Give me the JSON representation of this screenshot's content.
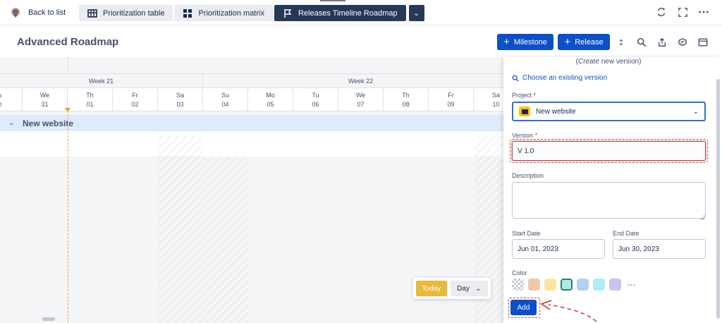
{
  "topbar": {
    "back_label": "Back to list",
    "tabs": [
      {
        "label": "Prioritization table",
        "icon": "table-icon",
        "active": false
      },
      {
        "label": "Prioritization matrix",
        "icon": "matrix-icon",
        "active": false
      },
      {
        "label": "Releases Timeline Roadmap",
        "icon": "flag-icon",
        "active": true
      }
    ],
    "icons": [
      "refresh-icon",
      "fullscreen-icon",
      "more-icon"
    ]
  },
  "header": {
    "title": "Advanced Roadmap",
    "milestone_label": "Milestone",
    "release_label": "Release",
    "icons": [
      "sort-icon",
      "search-icon",
      "share-icon",
      "comment-icon",
      "panel-icon"
    ]
  },
  "timeline": {
    "weeks": [
      {
        "label": "Week 21"
      },
      {
        "label": "Week 22"
      }
    ],
    "days": [
      {
        "dow": "u",
        "date": "0"
      },
      {
        "dow": "We",
        "date": "31"
      },
      {
        "dow": "Th",
        "date": "01"
      },
      {
        "dow": "Fr",
        "date": "02"
      },
      {
        "dow": "Sa",
        "date": "03"
      },
      {
        "dow": "Su",
        "date": "04"
      },
      {
        "dow": "Mo",
        "date": "05"
      },
      {
        "dow": "Tu",
        "date": "06"
      },
      {
        "dow": "We",
        "date": "07"
      },
      {
        "dow": "Th",
        "date": "08"
      },
      {
        "dow": "Fr",
        "date": "09"
      },
      {
        "dow": "Sa",
        "date": "10"
      }
    ],
    "group_name": "New website",
    "today_label": "Today",
    "zoom_label": "Day"
  },
  "panel": {
    "create_label": "(Create new version)",
    "choose_label": "Choose an existing version",
    "project_label": "Project",
    "project_value": "New website",
    "version_label": "Version",
    "version_value": "V 1.0",
    "description_label": "Description",
    "start_label": "Start Date",
    "start_value": "Jun 01, 2023",
    "end_label": "End Date",
    "end_value": "Jun 30, 2023",
    "color_label": "Color",
    "required_mark": "*",
    "swatches": [
      "transparent",
      "#f0c8a8",
      "#fbe4a4",
      "#aee8e0",
      "#b3d0f5",
      "#b0ecf5",
      "#cbc2f0"
    ],
    "selected_swatch": 3,
    "add_label": "Add"
  }
}
